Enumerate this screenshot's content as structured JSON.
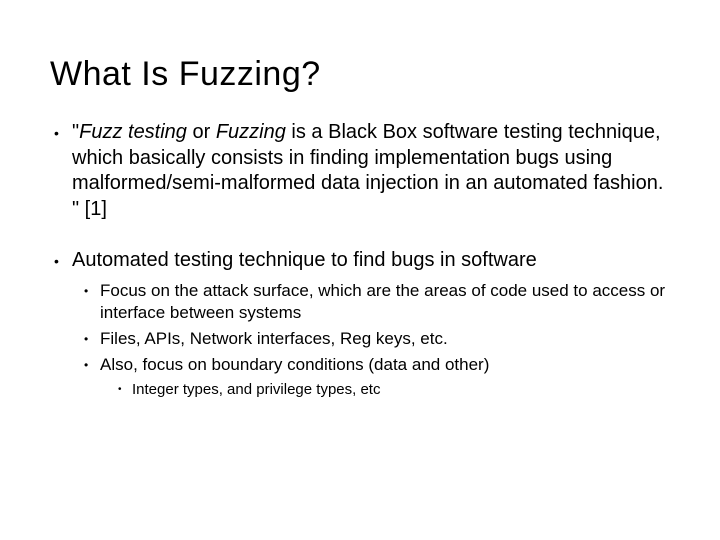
{
  "title": "What Is Fuzzing?",
  "bullets": {
    "b1": {
      "quoteOpen": "\"",
      "italic1": "Fuzz testing",
      "mid1": " or ",
      "italic2": "Fuzzing",
      "rest": " is a Black Box software testing technique, which basically consists in finding implementation bugs using malformed/semi-malformed data injection in an automated fashion. \" [1]"
    },
    "b2": {
      "text": "Automated testing technique to find bugs in software",
      "sub": {
        "s1": "Focus on the attack surface, which are the areas of code used to access or interface between systems",
        "s2": "Files, APIs, Network interfaces, Reg keys, etc.",
        "s3": "Also, focus on boundary conditions (data and other)",
        "s3sub": {
          "t1": "Integer types, and privilege types, etc"
        }
      }
    }
  }
}
